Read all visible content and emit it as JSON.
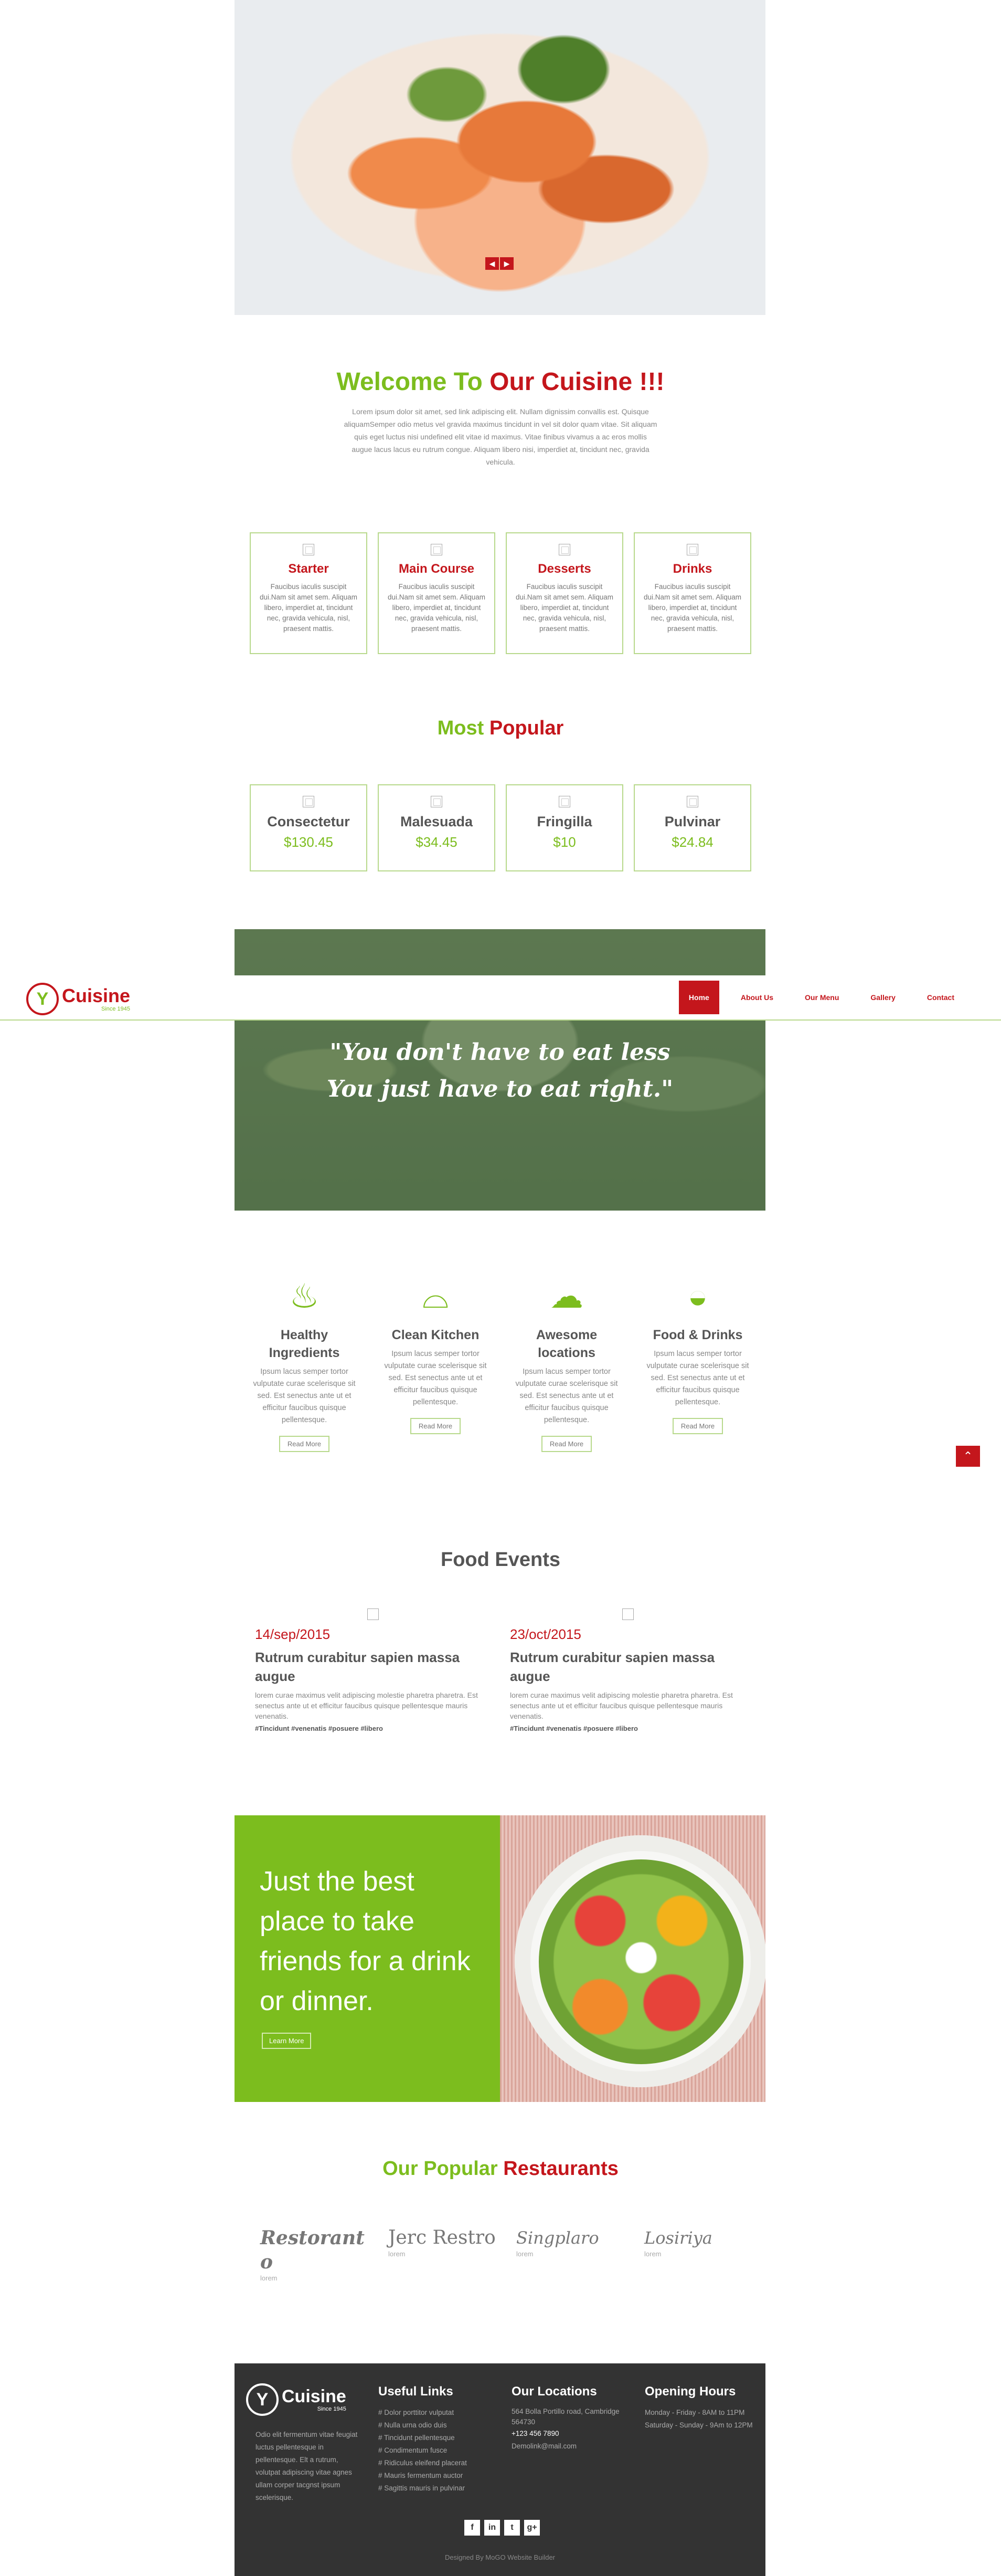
{
  "hero": {
    "prev_icon": "arrow-left",
    "next_icon": "arrow-right",
    "prev_glyph": "◀",
    "next_glyph": "▶"
  },
  "welcome": {
    "title_part1": "Welcome To ",
    "title_part2": "Our Cuisine !!!",
    "text": "Lorem ipsum dolor sit amet, sed link adipiscing elit. Nullam dignissim convallis est. Quisque aliquamSemper odio metus vel gravida maximus tincidunt in vel sit dolor quam vitae. Sit aliquam quis eget luctus nisi undefined elit vitae id maximus. Vitae finibus vivamus a ac eros mollis augue lacus lacus eu rutrum congue. Aliquam libero nisi, imperdiet at, tincidunt nec, gravida vehicula."
  },
  "courses": [
    {
      "title": "Starter",
      "text": "Faucibus iaculis suscipit dui.Nam sit amet sem. Aliquam libero, imperdiet at, tincidunt nec, gravida vehicula, nisl, praesent mattis."
    },
    {
      "title": "Main Course",
      "text": "Faucibus iaculis suscipit dui.Nam sit amet sem. Aliquam libero, imperdiet at, tincidunt nec, gravida vehicula, nisl, praesent mattis."
    },
    {
      "title": "Desserts",
      "text": "Faucibus iaculis suscipit dui.Nam sit amet sem. Aliquam libero, imperdiet at, tincidunt nec, gravida vehicula, nisl, praesent mattis."
    },
    {
      "title": "Drinks",
      "text": "Faucibus iaculis suscipit dui.Nam sit amet sem. Aliquam libero, imperdiet at, tincidunt nec, gravida vehicula, nisl, praesent mattis."
    }
  ],
  "popular": {
    "title_part1": "Most ",
    "title_part2": "Popular",
    "items": [
      {
        "name": "Consectetur",
        "price": "$130.45"
      },
      {
        "name": "Malesuada",
        "price": "$34.45"
      },
      {
        "name": "Fringilla",
        "price": "$10"
      },
      {
        "name": "Pulvinar",
        "price": "$24.84"
      }
    ]
  },
  "nav": {
    "logo_mark": "Y",
    "brand": "Cuisine",
    "tagline": "Since 1945",
    "items": [
      "Home",
      "About Us",
      "Our Menu",
      "Gallery",
      "Contact"
    ],
    "active": "Home"
  },
  "quote": {
    "line1": "\"You don't have to eat less",
    "line2": "You just have to eat right.\""
  },
  "features": [
    {
      "icon": "steam-dish-icon",
      "glyph": "♨",
      "title": "Healthy Ingredients",
      "text": "Ipsum lacus semper tortor vulputate curae scelerisque sit sed. Est senectus ante ut et efficitur faucibus quisque pellentesque.",
      "button": "Read More"
    },
    {
      "icon": "cloche-icon",
      "glyph": "⌓",
      "title": "Clean Kitchen",
      "text": "Ipsum lacus semper tortor vulputate curae scelerisque sit sed. Est senectus ante ut et efficitur faucibus quisque pellentesque.",
      "button": "Read More"
    },
    {
      "icon": "chef-hat-icon",
      "glyph": "☁",
      "title": "Awesome locations",
      "text": "Ipsum lacus semper tortor vulputate curae scelerisque sit sed. Est senectus ante ut et efficitur faucibus quisque pellentesque.",
      "button": "Read More"
    },
    {
      "icon": "salad-bowl-icon",
      "glyph": "◒",
      "title": "Food & Drinks",
      "text": "Ipsum lacus semper tortor vulputate curae scelerisque sit sed. Est senectus ante ut et efficitur faucibus quisque pellentesque.",
      "button": "Read More"
    }
  ],
  "back_to_top": "⌃",
  "events": {
    "title": "Food Events",
    "items": [
      {
        "date": "14/sep/2015",
        "title": "Rutrum curabitur sapien massa augue",
        "text": "lorem curae maximus velit adipiscing molestie pharetra pharetra. Est senectus ante ut et efficitur faucibus quisque pellentesque mauris venenatis.",
        "tags": "#Tincidunt #venenatis #posuere #libero"
      },
      {
        "date": "23/oct/2015",
        "title": "Rutrum curabitur sapien massa augue",
        "text": "lorem curae maximus velit adipiscing molestie pharetra pharetra. Est senectus ante ut et efficitur faucibus quisque pellentesque mauris venenatis.",
        "tags": "#Tincidunt #venenatis #posuere #libero"
      }
    ]
  },
  "promo": {
    "headline": "Just the best place to take friends for a drink or dinner.",
    "button": "Learn More"
  },
  "restaurants": {
    "title_part1": "Our Popular ",
    "title_part2": "Restaurants",
    "items": [
      {
        "name": "Restorant o",
        "sub": "lorem"
      },
      {
        "name": "Jerc Restro",
        "sub": "lorem"
      },
      {
        "name": "Singplaro",
        "sub": "lorem"
      },
      {
        "name": "Losiriya",
        "sub": "lorem"
      }
    ]
  },
  "footer": {
    "brand": "Cuisine",
    "tagline": "Since 1945",
    "logo_mark": "Y",
    "about": "Odio elit fermentum vitae feugiat luctus pellentesque in pellentesque. Elt a rutrum, volutpat adipiscing vitae agnes ullam corper tacgnst ipsum scelerisque.",
    "links_title": "Useful Links",
    "links": [
      "# Dolor porttitor vulputat",
      "# Nulla urna odio duis",
      "# Tincidunt pellentesque",
      "# Condimentum fusce",
      "# Ridiculus eleifend placerat",
      "# Mauris fermentum auctor",
      "# Sagittis mauris in pulvinar"
    ],
    "loc_title": "Our Locations",
    "address": "564 Bolla Portillo road, Cambridge 564730",
    "phone": "+123 456 7890",
    "email": "Demolink@mail.com",
    "hours_title": "Opening Hours",
    "hours1": "Monday - Friday - 8AM to 11PM",
    "hours2": "Saturday - Sunday - 9Am to 12PM",
    "social": [
      {
        "icon": "facebook-icon",
        "glyph": "f"
      },
      {
        "icon": "linkedin-icon",
        "glyph": "in"
      },
      {
        "icon": "tumblr-icon",
        "glyph": "t"
      },
      {
        "icon": "googleplus-icon",
        "glyph": "g+"
      }
    ],
    "credit": "Designed By MoGO Website Builder"
  }
}
